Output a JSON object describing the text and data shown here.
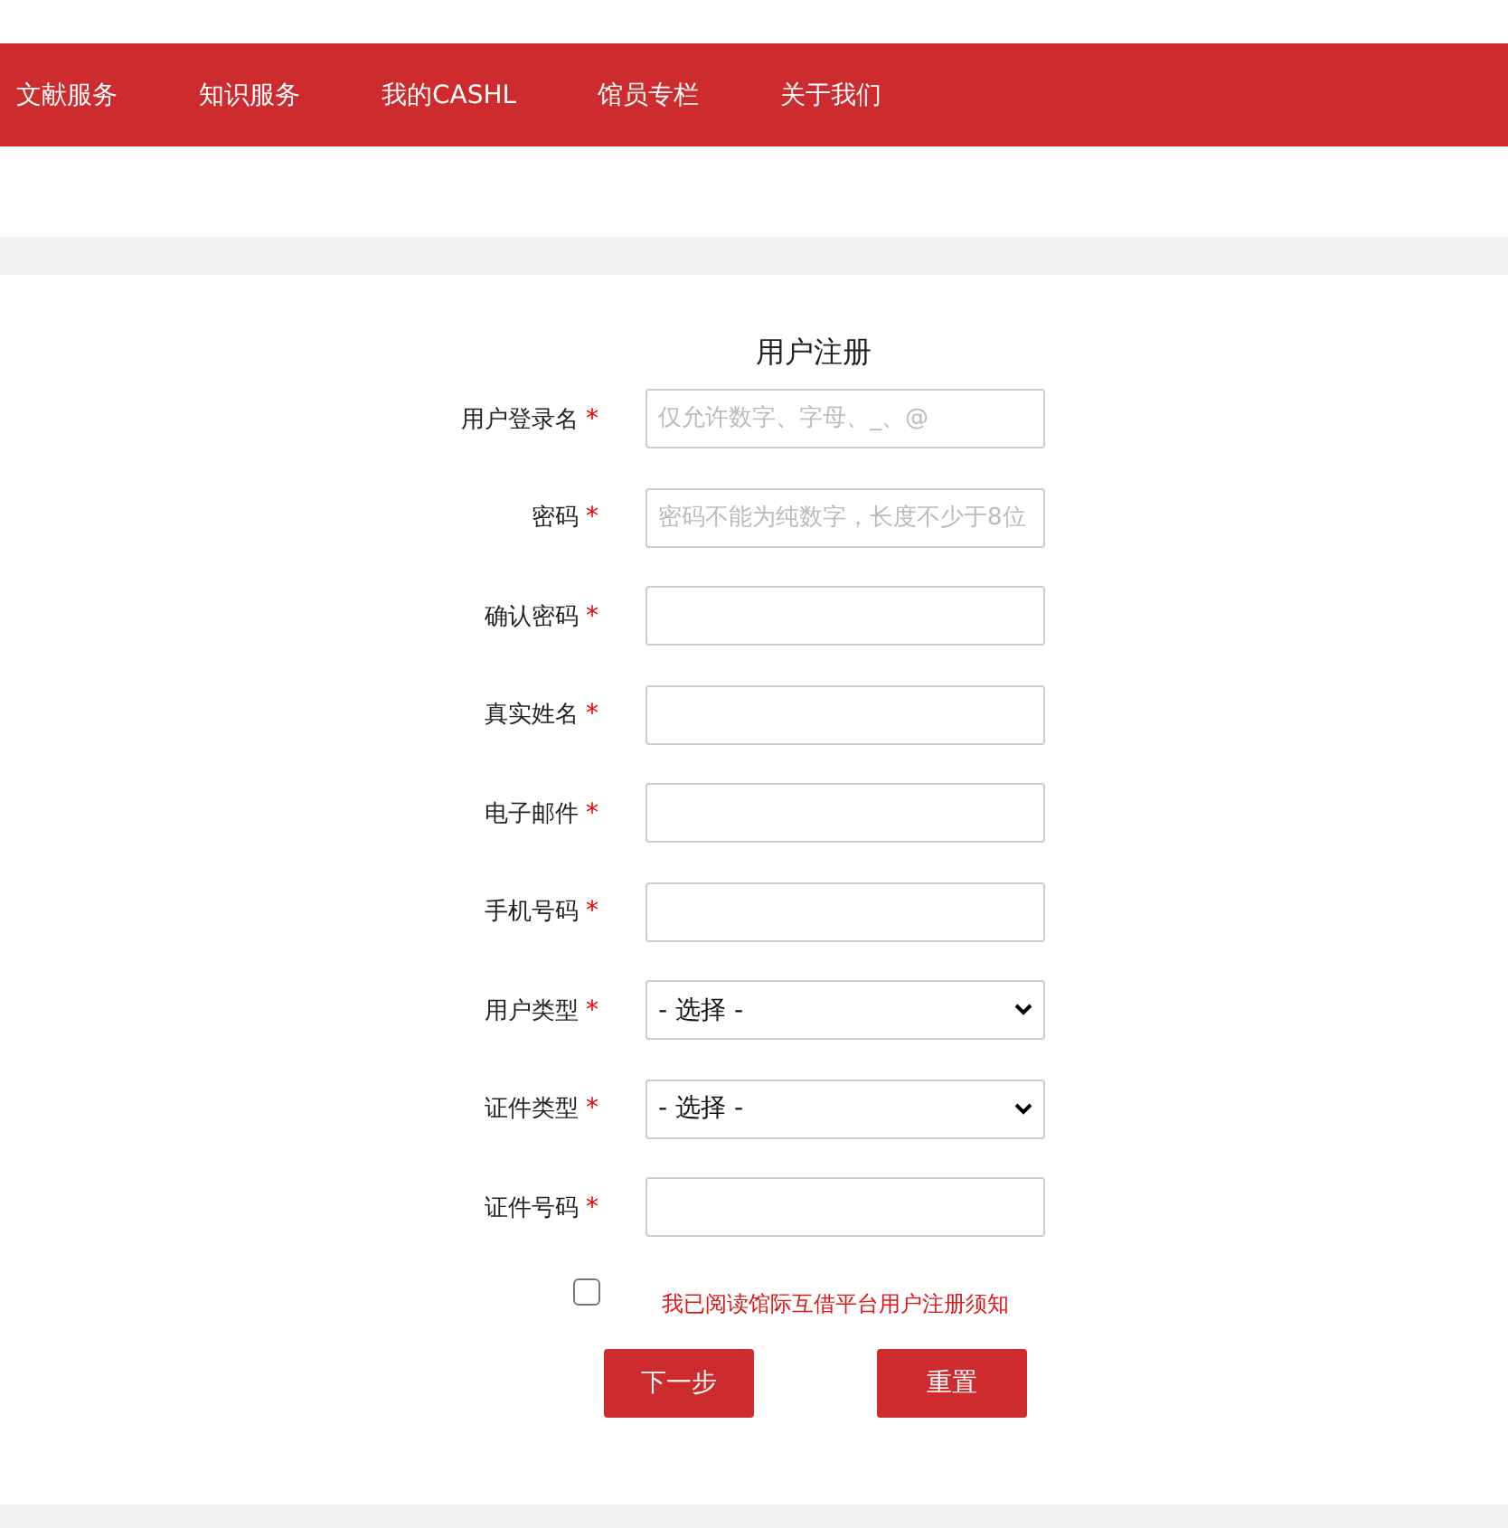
{
  "nav": {
    "items": [
      {
        "label": "文献服务"
      },
      {
        "label": "知识服务"
      },
      {
        "label": "我的CASHL"
      },
      {
        "label": "馆员专栏"
      },
      {
        "label": "关于我们"
      }
    ]
  },
  "form": {
    "title": "用户注册",
    "fields": [
      {
        "kind": "text",
        "label": "用户登录名",
        "required_mark": "*",
        "placeholder": "仅允许数字、字母、_、@"
      },
      {
        "kind": "text",
        "label": "密码",
        "required_mark": "*",
        "placeholder": "密码不能为纯数字，长度不少于8位"
      },
      {
        "kind": "text",
        "label": "确认密码",
        "required_mark": "*"
      },
      {
        "kind": "text",
        "label": "真实姓名",
        "required_mark": "*"
      },
      {
        "kind": "text",
        "label": "电子邮件",
        "required_mark": "*"
      },
      {
        "kind": "text",
        "label": "手机号码",
        "required_mark": "*"
      },
      {
        "kind": "select",
        "label": "用户类型",
        "required_mark": "*",
        "value": "- 选择 -"
      },
      {
        "kind": "select",
        "label": "证件类型",
        "required_mark": "*",
        "value": "- 选择 -"
      },
      {
        "kind": "text",
        "label": "证件号码",
        "required_mark": "*"
      }
    ],
    "agreement": {
      "checked": false,
      "text": "我已阅读馆际互借平台用户注册须知"
    },
    "buttons": [
      "下一步",
      "重置"
    ]
  }
}
